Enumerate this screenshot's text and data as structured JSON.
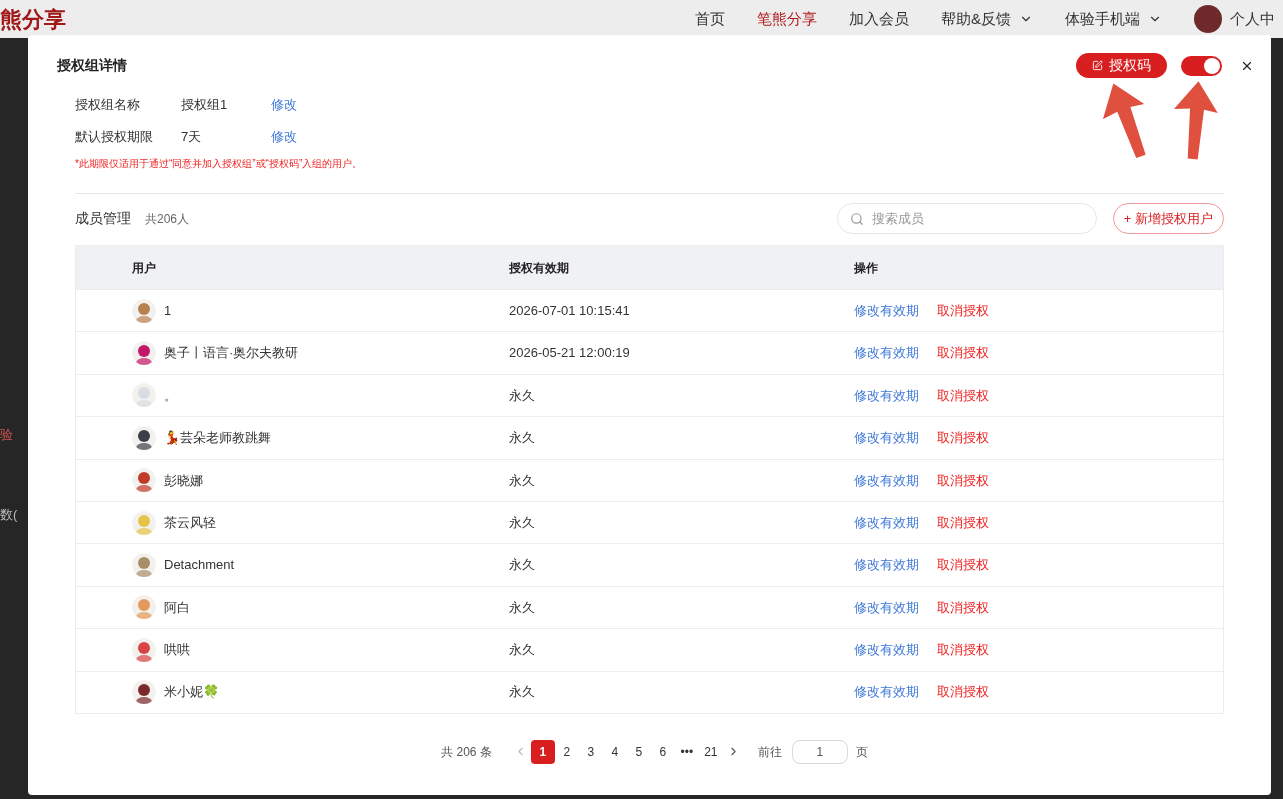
{
  "nav": {
    "logo": "熊分享",
    "items": [
      {
        "label": "首页",
        "selected": false,
        "dropdown": false
      },
      {
        "label": "笔熊分享",
        "selected": true,
        "dropdown": false
      },
      {
        "label": "加入会员",
        "selected": false,
        "dropdown": false
      },
      {
        "label": "帮助&反馈",
        "selected": false,
        "dropdown": true
      },
      {
        "label": "体验手机端",
        "selected": false,
        "dropdown": true
      }
    ],
    "user": "个人中"
  },
  "background_fragments": [
    "验",
    "数("
  ],
  "dialog": {
    "title": "授权组详情",
    "code_button": "授权码",
    "toggle": {
      "on": true
    },
    "fields": [
      {
        "label": "授权组名称",
        "value": "授权组1",
        "action": "修改"
      },
      {
        "label": "默认授权期限",
        "value": "7天",
        "action": "修改"
      }
    ],
    "note": "*此期限仅适用于通过“同意并加入授权组”或“授权码”入组的用户。",
    "members": {
      "title": "成员管理",
      "count": "共206人",
      "search": {
        "placeholder": "搜索成员"
      },
      "add_button": "+ 新增授权用户"
    },
    "table": {
      "columns": [
        "用户",
        "授权有效期",
        "操作"
      ],
      "rows": [
        {
          "user": "1",
          "expiry": "2026-07-01 10:15:41",
          "actions": [
            "修改有效期",
            "取消授权"
          ]
        },
        {
          "user": "奥子丨语言·奥尔夫教研",
          "expiry": "2026-05-21 12:00:19",
          "actions": [
            "修改有效期",
            "取消授权"
          ]
        },
        {
          "user": "。",
          "expiry": "永久",
          "actions": [
            "修改有效期",
            "取消授权"
          ]
        },
        {
          "user": "💃芸朵老师教跳舞",
          "expiry": "永久",
          "actions": [
            "修改有效期",
            "取消授权"
          ]
        },
        {
          "user": "彭晓娜",
          "expiry": "永久",
          "actions": [
            "修改有效期",
            "取消授权"
          ]
        },
        {
          "user": "茶云风轻",
          "expiry": "永久",
          "actions": [
            "修改有效期",
            "取消授权"
          ]
        },
        {
          "user": "Detachment",
          "expiry": "永久",
          "actions": [
            "修改有效期",
            "取消授权"
          ]
        },
        {
          "user": "阿白",
          "expiry": "永久",
          "actions": [
            "修改有效期",
            "取消授权"
          ]
        },
        {
          "user": "哄哄",
          "expiry": "永久",
          "actions": [
            "修改有效期",
            "取消授权"
          ]
        },
        {
          "user": "米小妮🍀",
          "expiry": "永久",
          "actions": [
            "修改有效期",
            "取消授权"
          ]
        }
      ]
    },
    "pagination": {
      "total": "共 206 条",
      "pages": [
        {
          "label": "1",
          "selected": true
        },
        {
          "label": "2",
          "selected": false
        },
        {
          "label": "3",
          "selected": false
        },
        {
          "label": "4",
          "selected": false
        },
        {
          "label": "5",
          "selected": false
        },
        {
          "label": "6",
          "selected": false
        },
        {
          "label": "•••",
          "selected": false
        },
        {
          "label": "21",
          "selected": false
        }
      ],
      "goto_label": "前往",
      "goto_value": "1",
      "page_suffix": "页"
    }
  }
}
